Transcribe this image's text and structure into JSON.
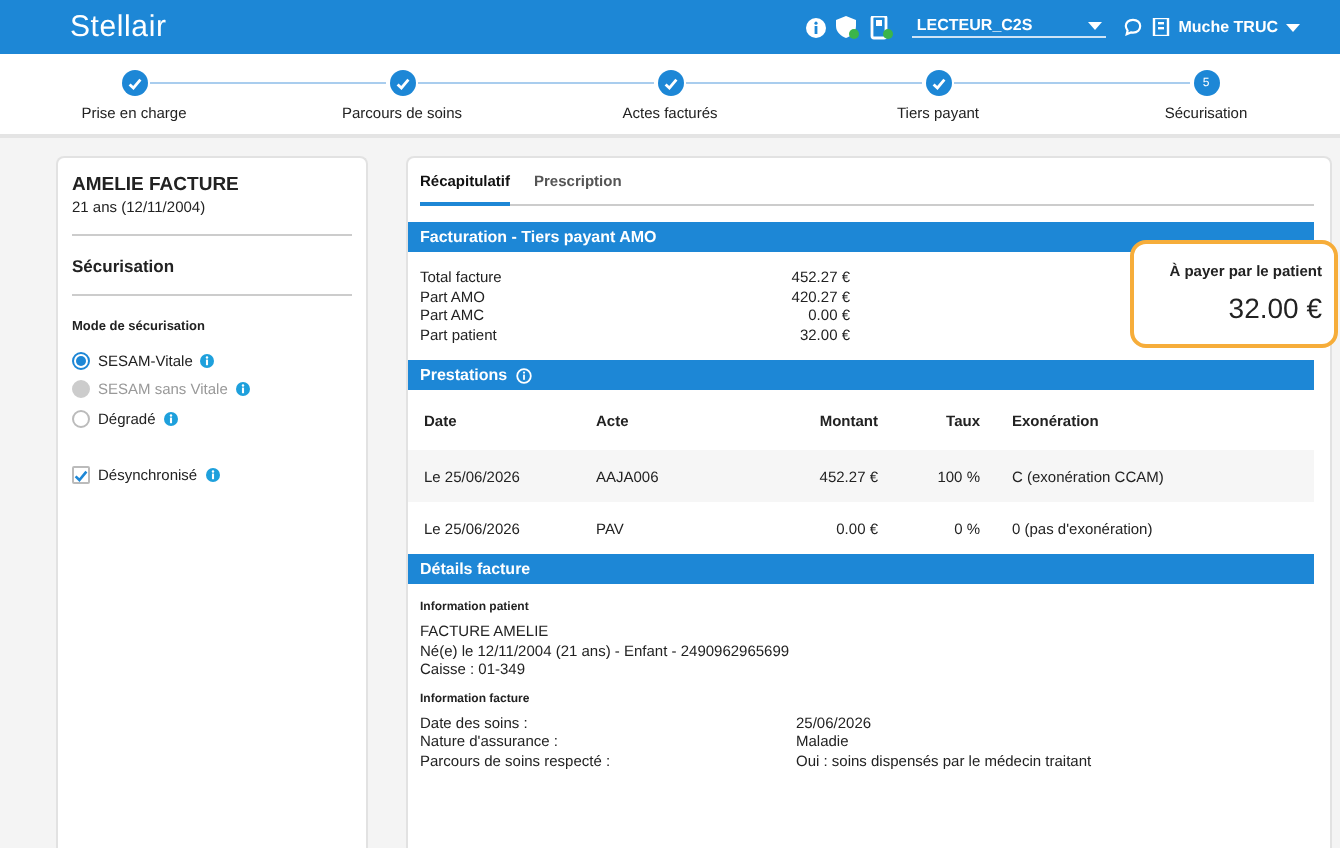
{
  "header": {
    "logo": "Stellair",
    "reader": "LECTEUR_C2S",
    "user": "Muche TRUC"
  },
  "steps": [
    {
      "label": "Prise en charge",
      "done": true
    },
    {
      "label": "Parcours de soins",
      "done": true
    },
    {
      "label": "Actes facturés",
      "done": true
    },
    {
      "label": "Tiers payant",
      "done": true
    },
    {
      "label": "Sécurisation",
      "done": false,
      "number": "5"
    }
  ],
  "patient": {
    "name": "AMELIE FACTURE",
    "age": "21 ans (12/11/2004)"
  },
  "securisation": {
    "title": "Sécurisation",
    "mode_label": "Mode de sécurisation",
    "modes": [
      {
        "label": "SESAM-Vitale",
        "selected": true,
        "disabled": false
      },
      {
        "label": "SESAM sans Vitale",
        "selected": false,
        "disabled": true
      },
      {
        "label": "Dégradé",
        "selected": false,
        "disabled": false
      }
    ],
    "desync": {
      "label": "Désynchronisé",
      "checked": true
    }
  },
  "tabs": [
    {
      "label": "Récapitulatif",
      "selected": true
    },
    {
      "label": "Prescription",
      "selected": false
    }
  ],
  "facturation": {
    "title": "Facturation - Tiers payant AMO",
    "rows": [
      {
        "label": "Total facture",
        "value": "452.27 €"
      },
      {
        "label": "Part AMO",
        "value": "420.27 €"
      },
      {
        "label": "Part AMC",
        "value": "0.00 €"
      },
      {
        "label": "Part patient",
        "value": "32.00 €"
      }
    ],
    "to_pay_label": "À payer par le patient",
    "to_pay": "32.00 €"
  },
  "prestations": {
    "title": "Prestations",
    "columns": [
      "Date",
      "Acte",
      "Montant",
      "Taux",
      "Exonération"
    ],
    "rows": [
      [
        "Le 25/06/2026",
        "AAJA006",
        "452.27 €",
        "100 %",
        "C (exonération CCAM)"
      ],
      [
        "Le 25/06/2026",
        "PAV",
        "0.00 €",
        "0 %",
        "0 (pas d'exonération)"
      ]
    ]
  },
  "details": {
    "title": "Détails facture",
    "patient_heading": "Information patient",
    "patient_lines": [
      "FACTURE AMELIE",
      "Né(e) le 12/11/2004 (21 ans) - Enfant - 2490962965699",
      "Caisse : 01-349"
    ],
    "facture_heading": "Information facture",
    "facture_rows": [
      {
        "label": "Date des soins :",
        "value": "25/06/2026"
      },
      {
        "label": "Nature d'assurance :",
        "value": "Maladie"
      },
      {
        "label": "Parcours de soins respecté :",
        "value": "Oui : soins dispensés par le médecin traitant"
      }
    ]
  }
}
